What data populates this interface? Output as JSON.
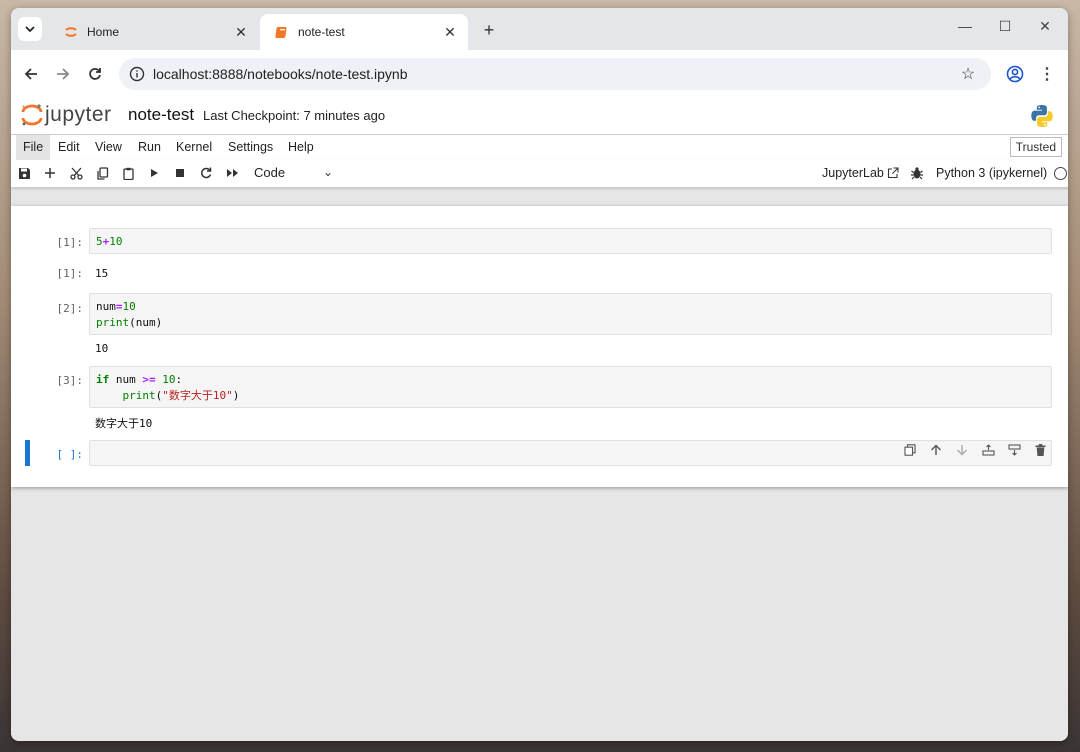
{
  "browser": {
    "tabs": [
      {
        "title": "Home",
        "icon": "jupyter-tab-icon",
        "active": false
      },
      {
        "title": "note-test",
        "icon": "notebook-tab-icon",
        "active": true
      }
    ],
    "url": "localhost:8888/notebooks/note-test.ipynb"
  },
  "jupyter": {
    "logo_text": "jupyter",
    "notebook_name": "note-test",
    "checkpoint": "Last Checkpoint: 7 minutes ago",
    "menu": [
      "File",
      "Edit",
      "View",
      "Run",
      "Kernel",
      "Settings",
      "Help"
    ],
    "trusted": "Trusted",
    "cell_type": "Code",
    "jupyterlab_link": "JupyterLab",
    "kernel_name": "Python 3 (ipykernel)"
  },
  "cells": [
    {
      "prompt": "[1]:",
      "output_prompt": "[1]:",
      "code": "5+10",
      "output": "15"
    },
    {
      "prompt": "[2]:",
      "code": "num=10\nprint(num)",
      "output": "10"
    },
    {
      "prompt": "[3]:",
      "code": "if num >= 10:\n    print(\"数字大于10\")",
      "output": "数字大于10"
    },
    {
      "prompt": "[ ]:",
      "code": ""
    }
  ],
  "colors": {
    "accent": "#1976d2",
    "code_string": "#ba2121",
    "code_number": "#008000"
  }
}
